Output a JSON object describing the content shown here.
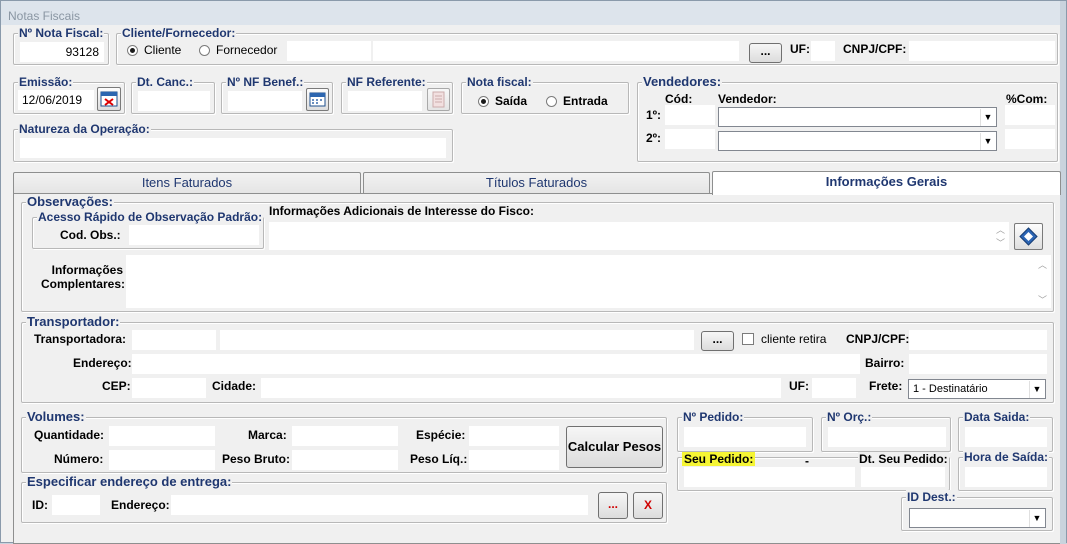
{
  "window": {
    "title": "Notas Fiscais"
  },
  "nota": {
    "label": "Nº Nota Fiscal:",
    "value": "93128"
  },
  "cliente": {
    "label": "Cliente/Fornecedor:",
    "opt_cliente": "Cliente",
    "opt_fornecedor": "Fornecedor",
    "code": "",
    "name": "",
    "browse": "...",
    "uf_label": "UF:",
    "uf": "",
    "cnpj_label": "CNPJ/CPF:",
    "cnpj": ""
  },
  "emissao": {
    "label": "Emissão:",
    "value": "12/06/2019"
  },
  "dtcanc": {
    "label": "Dt. Canc.:",
    "value": ""
  },
  "nfbenef": {
    "label": "Nº NF Benef.:",
    "value": ""
  },
  "nfref": {
    "label": "NF Referente:",
    "value": ""
  },
  "tipo": {
    "label": "Nota fiscal:",
    "saida": "Saída",
    "entrada": "Entrada"
  },
  "vendedores": {
    "label": "Vendedores:",
    "cod_label": "Cód:",
    "vend_label": "Vendedor:",
    "com_label": "%Com:",
    "row1": "1º:",
    "row2": "2º:"
  },
  "natureza": {
    "label": "Natureza da Operação:",
    "value": ""
  },
  "tabs": [
    "Itens Faturados",
    "Títulos Faturados",
    "Informações Gerais"
  ],
  "obs": {
    "label": "Observações:",
    "acesso_label": "Acesso Rápido de Observação Padrão:",
    "cod_label": "Cod. Obs.:",
    "fisco_label": "Informações Adicionais de Interesse do Fisco:",
    "comp_label1": "Informações",
    "comp_label2": "Complentares:"
  },
  "transp": {
    "label": "Transportador:",
    "transportadora": "Transportadora:",
    "browse": "...",
    "retira": "cliente retira",
    "cnpj": "CNPJ/CPF:",
    "endereco": "Endereço:",
    "bairro": "Bairro:",
    "cep": "CEP:",
    "cidade": "Cidade:",
    "uf": "UF:",
    "frete": "Frete:",
    "frete_value": "1 - Destinatário"
  },
  "volumes": {
    "label": "Volumes:",
    "quantidade": "Quantidade:",
    "marca": "Marca:",
    "especie": "Espécie:",
    "numero": "Número:",
    "peso_bruto": "Peso Bruto:",
    "peso_liq": "Peso Líq.:",
    "calc": "Calcular Pesos"
  },
  "entrega": {
    "label": "Especificar endereço de entrega:",
    "id": "ID:",
    "endereco": "Endereço:",
    "browse": "...",
    "clear": "X"
  },
  "pedido": {
    "num": "Nº Pedido:",
    "orc": "Nº Orç.:",
    "data_saida": "Data Saida:",
    "seu_pedido": "Seu Pedido:",
    "dash": "-",
    "dt_seu": "Dt. Seu Pedido:",
    "hora": "Hora de Saída:",
    "iddest": "ID Dest.:"
  }
}
